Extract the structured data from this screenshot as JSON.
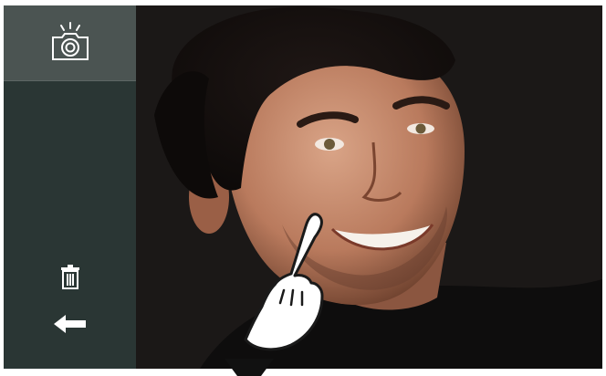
{
  "screen": {
    "title": "",
    "sidebar": {
      "capture_button": {
        "icon": "camera-flash-icon"
      },
      "delete_button": {
        "icon": "trash-icon"
      },
      "back_button": {
        "icon": "arrow-left-icon"
      }
    },
    "photo": {
      "subject": "",
      "overlay_icon": "pointing-hand-icon"
    }
  },
  "colors": {
    "sidebar_bg": "#2a3634",
    "sidebar_active_bg": "#4b5452",
    "icon_color": "#ffffff",
    "photo_bg": "#1a1817"
  }
}
